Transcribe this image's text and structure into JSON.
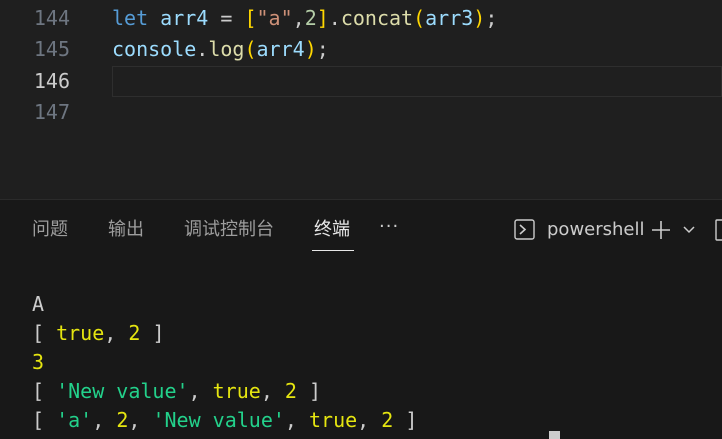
{
  "editor": {
    "lines": [
      {
        "number": "144",
        "tokens": [
          {
            "t": "let",
            "c": "kw"
          },
          {
            "t": " ",
            "c": "punc"
          },
          {
            "t": "arr4",
            "c": "var"
          },
          {
            "t": " = ",
            "c": "punc"
          },
          {
            "t": "[",
            "c": "br1"
          },
          {
            "t": "\"a\"",
            "c": "str"
          },
          {
            "t": ",",
            "c": "punc"
          },
          {
            "t": "2",
            "c": "num"
          },
          {
            "t": "]",
            "c": "br1"
          },
          {
            "t": ".",
            "c": "punc"
          },
          {
            "t": "concat",
            "c": "fn"
          },
          {
            "t": "(",
            "c": "br1"
          },
          {
            "t": "arr3",
            "c": "var"
          },
          {
            "t": ")",
            "c": "br1"
          },
          {
            "t": ";",
            "c": "punc"
          }
        ]
      },
      {
        "number": "145",
        "tokens": [
          {
            "t": "console",
            "c": "var"
          },
          {
            "t": ".",
            "c": "punc"
          },
          {
            "t": "log",
            "c": "fn"
          },
          {
            "t": "(",
            "c": "br1"
          },
          {
            "t": "arr4",
            "c": "var"
          },
          {
            "t": ")",
            "c": "br1"
          },
          {
            "t": ";",
            "c": "punc"
          }
        ]
      },
      {
        "number": "146",
        "tokens": [],
        "current": true
      },
      {
        "number": "147",
        "tokens": []
      }
    ]
  },
  "panel": {
    "tabs": [
      {
        "label": "问题",
        "name": "tab-problems"
      },
      {
        "label": "输出",
        "name": "tab-output"
      },
      {
        "label": "调试控制台",
        "name": "tab-debug-console"
      },
      {
        "label": "终端",
        "name": "tab-terminal",
        "active": true
      }
    ],
    "more_label": "···",
    "shell_label": "powershell",
    "icons": {
      "terminal": "terminal-icon",
      "add": "plus-icon",
      "dropdown": "chevron-down-icon",
      "split": "split-terminal-icon",
      "more": "ellipsis-icon"
    }
  },
  "terminal": {
    "output": [
      [
        {
          "t": "A",
          "c": "t-default"
        }
      ],
      [
        {
          "t": "[ ",
          "c": "t-default"
        },
        {
          "t": "true",
          "c": "t-yellow"
        },
        {
          "t": ", ",
          "c": "t-default"
        },
        {
          "t": "2",
          "c": "t-yellow"
        },
        {
          "t": " ]",
          "c": "t-default"
        }
      ],
      [
        {
          "t": "3",
          "c": "t-yellow"
        }
      ],
      [
        {
          "t": "[ ",
          "c": "t-default"
        },
        {
          "t": "'New value'",
          "c": "t-green"
        },
        {
          "t": ", ",
          "c": "t-default"
        },
        {
          "t": "true",
          "c": "t-yellow"
        },
        {
          "t": ", ",
          "c": "t-default"
        },
        {
          "t": "2",
          "c": "t-yellow"
        },
        {
          "t": " ]",
          "c": "t-default"
        }
      ],
      [
        {
          "t": "[ ",
          "c": "t-default"
        },
        {
          "t": "'a'",
          "c": "t-green"
        },
        {
          "t": ", ",
          "c": "t-default"
        },
        {
          "t": "2",
          "c": "t-yellow"
        },
        {
          "t": ", ",
          "c": "t-default"
        },
        {
          "t": "'New value'",
          "c": "t-green"
        },
        {
          "t": ", ",
          "c": "t-default"
        },
        {
          "t": "true",
          "c": "t-yellow"
        },
        {
          "t": ", ",
          "c": "t-default"
        },
        {
          "t": "2",
          "c": "t-yellow"
        },
        {
          "t": " ]",
          "c": "t-default"
        }
      ]
    ]
  },
  "colors": {
    "editor_bg": "#1f1f1f",
    "panel_bg": "#181818",
    "keyword": "#569cd6",
    "variable": "#9cdcfe",
    "function": "#dcdcaa",
    "string": "#ce9178",
    "number": "#b5cea8",
    "bracket": "#ffd700",
    "term_yellow": "#e5e510",
    "term_green": "#23d18b"
  }
}
